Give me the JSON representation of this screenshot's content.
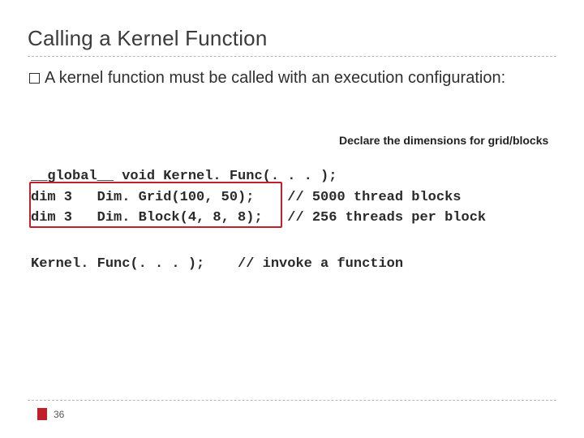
{
  "title": "Calling a Kernel Function",
  "bullet": {
    "text_before": "A",
    "text_after": " kernel function must be called with an execution configuration:"
  },
  "annotation": "Declare the dimensions for grid/blocks",
  "code": {
    "line1": "__global__ void Kernel. Func(. . . );",
    "line2": "dim 3   Dim. Grid(100, 50);    // 5000 thread blocks",
    "line3": "dim 3   Dim. Block(4, 8, 8);   // 256 threads per block",
    "invoke": "Kernel. Func(. . . );    // invoke a function"
  },
  "page_number": "36"
}
